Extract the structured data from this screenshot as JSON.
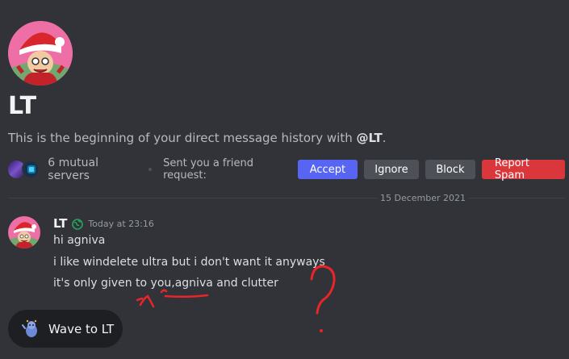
{
  "profile": {
    "display_name": "LT",
    "intro_prefix": "This is the beginning of your direct message history with ",
    "intro_handle": "@LT",
    "intro_suffix": "."
  },
  "mutual": {
    "servers_text": "6 mutual servers",
    "friend_request_text": "Sent you a friend request:"
  },
  "actions": {
    "accept": "Accept",
    "ignore": "Ignore",
    "block": "Block",
    "report_spam": "Report Spam"
  },
  "divider": {
    "date": "15 December 2021"
  },
  "message": {
    "author": "LT",
    "timestamp": "Today at 23:16",
    "lines": [
      "hi agniva",
      "i like windelete ultra but i don't want it anyways",
      "it's only given to you,agniva and clutter"
    ]
  },
  "wave": {
    "label": "Wave to LT"
  },
  "colors": {
    "background": "#313338",
    "accept": "#5865f2",
    "secondary": "#4e5058",
    "danger": "#da373c",
    "annotation": "#e8262a"
  }
}
